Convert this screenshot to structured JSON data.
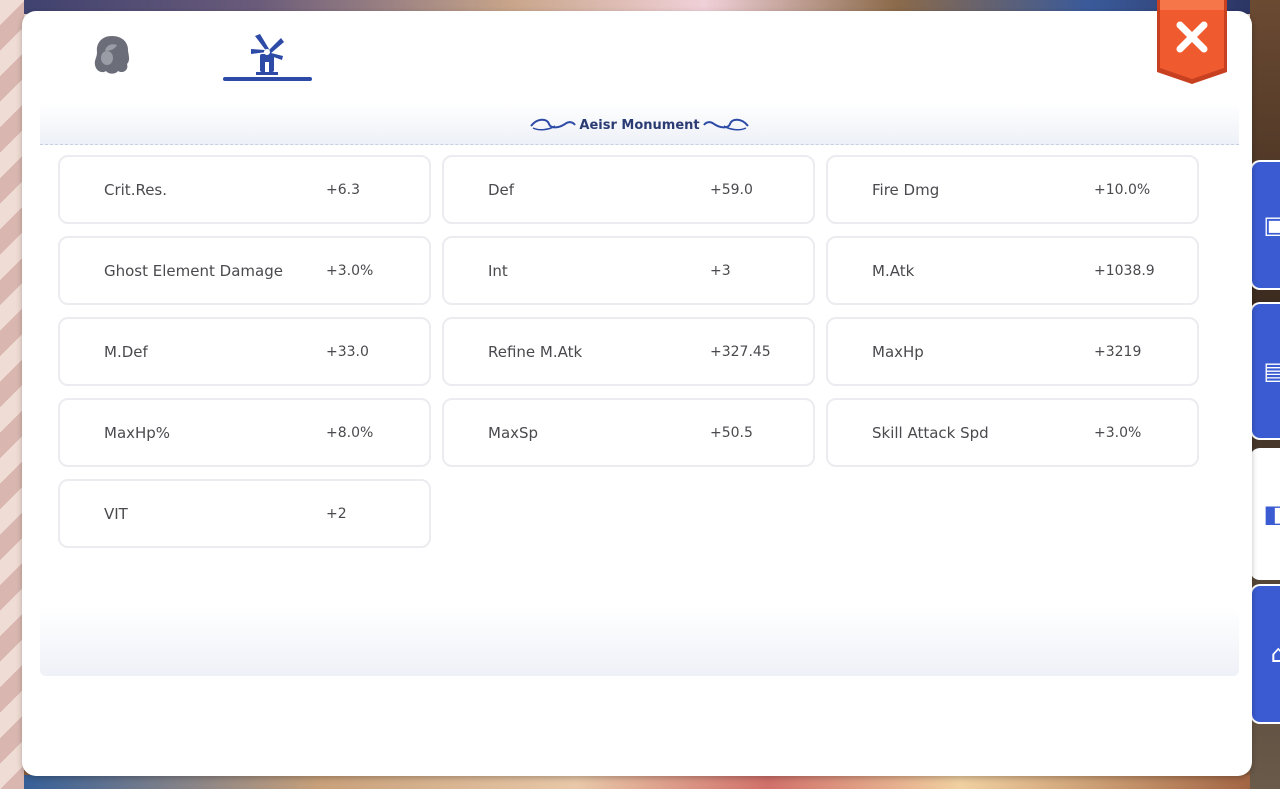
{
  "tabs": [
    {
      "name": "character",
      "icon": "character-head-icon"
    },
    {
      "name": "monument",
      "icon": "windmill-icon",
      "active": true
    }
  ],
  "section": {
    "title": "Aeisr Monument"
  },
  "stats": [
    {
      "name": "Crit.Res.",
      "value": "+6.3"
    },
    {
      "name": "Def",
      "value": "+59.0"
    },
    {
      "name": "Fire Dmg",
      "value": "+10.0%"
    },
    {
      "name": "Ghost Element Damage",
      "value": "+3.0%"
    },
    {
      "name": "Int",
      "value": "+3"
    },
    {
      "name": "M.Atk",
      "value": "+1038.9"
    },
    {
      "name": "M.Def",
      "value": "+33.0"
    },
    {
      "name": "Refine M.Atk",
      "value": "+327.45"
    },
    {
      "name": "MaxHp",
      "value": "+3219"
    },
    {
      "name": "MaxHp%",
      "value": "+8.0%"
    },
    {
      "name": "MaxSp",
      "value": "+50.5"
    },
    {
      "name": "Skill Attack Spd",
      "value": "+3.0%"
    },
    {
      "name": "VIT",
      "value": "+2"
    }
  ],
  "colors": {
    "accent": "#2c4aa6",
    "close_button": "#e8552d",
    "side_tab": "#3a5bd1",
    "text": "#4a4a4e"
  }
}
